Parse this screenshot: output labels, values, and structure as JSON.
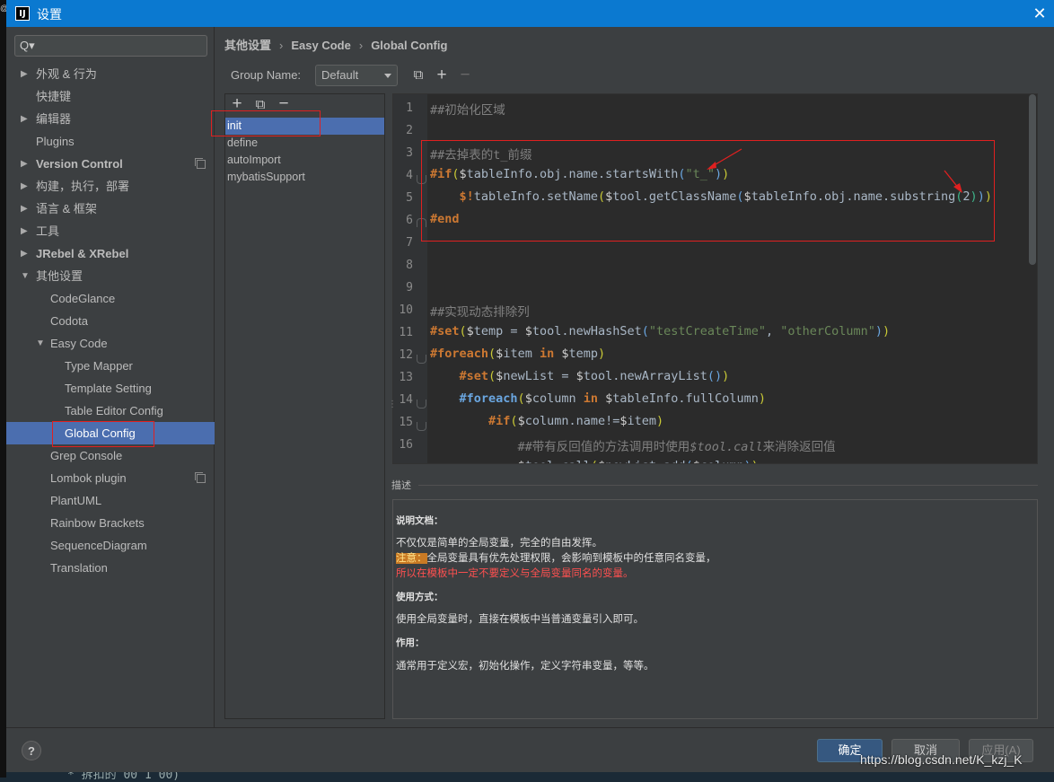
{
  "window": {
    "title": "设置",
    "app_icon": "IJ",
    "close": "✕"
  },
  "search": {
    "placeholder": "Q▾"
  },
  "nav": [
    {
      "label": "外观 & 行为",
      "arrow": "▶"
    },
    {
      "label": "快捷键"
    },
    {
      "label": "编辑器",
      "arrow": "▶"
    },
    {
      "label": "Plugins"
    },
    {
      "label": "Version Control",
      "arrow": "▶"
    },
    {
      "label": "构建，执行，部署",
      "arrow": "▶"
    },
    {
      "label": "语言 & 框架",
      "arrow": "▶"
    },
    {
      "label": "工具",
      "arrow": "▶"
    },
    {
      "label": "JRebel & XRebel",
      "arrow": "▶"
    },
    {
      "label": "其他设置",
      "arrow": "▼"
    },
    {
      "label": "CodeGlance"
    },
    {
      "label": "Codota"
    },
    {
      "label": "Easy Code",
      "arrow": "▼"
    },
    {
      "label": "Type Mapper"
    },
    {
      "label": "Template Setting"
    },
    {
      "label": "Table Editor Config"
    },
    {
      "label": "Global Config"
    },
    {
      "label": "Grep Console"
    },
    {
      "label": "Lombok plugin"
    },
    {
      "label": "PlantUML"
    },
    {
      "label": "Rainbow Brackets"
    },
    {
      "label": "SequenceDiagram"
    },
    {
      "label": "Translation"
    }
  ],
  "breadcrumb": {
    "items": [
      "其他设置",
      "Easy Code",
      "Global Config"
    ],
    "sep": "›"
  },
  "group": {
    "label": "Group Name:",
    "value": "Default"
  },
  "list_toolbar": {
    "add": "+",
    "copy": "⧉",
    "remove": "−"
  },
  "list_items": [
    "init",
    "define",
    "autoImport",
    "mybatisSupport"
  ],
  "editor": {
    "line_numbers": [
      "1",
      "2",
      "3",
      "4",
      "5",
      "6",
      "7",
      "8",
      "9",
      "10",
      "11",
      "12",
      "13",
      "14",
      "15",
      "16"
    ]
  },
  "description": {
    "header": "描述",
    "doc_title": "说明文档：",
    "line1": "不仅仅是简单的全局变量，完全的自由发挥。",
    "note_label": "注意：",
    "note_text": "全局变量具有优先处理权限，会影响到模板中的任意同名变量，",
    "warning": "所以在模板中一定不要定义与全局变量同名的变量。",
    "usage_title": "使用方式：",
    "usage_text": "使用全局变量时，直接在模板中当普通变量引入即可。",
    "purpose_title": "作用：",
    "purpose_text": "通常用于定义宏，初始化操作，定义字符串变量，等等。"
  },
  "footer": {
    "help": "?",
    "ok": "确定",
    "cancel": "取消",
    "apply": "应用(A)"
  },
  "watermark": "https://blog.csdn.net/K_kzj_K",
  "colors": {
    "accent": "#4b6eaf",
    "titlebar": "#0b79d0",
    "annotation_red": "#e02020"
  }
}
